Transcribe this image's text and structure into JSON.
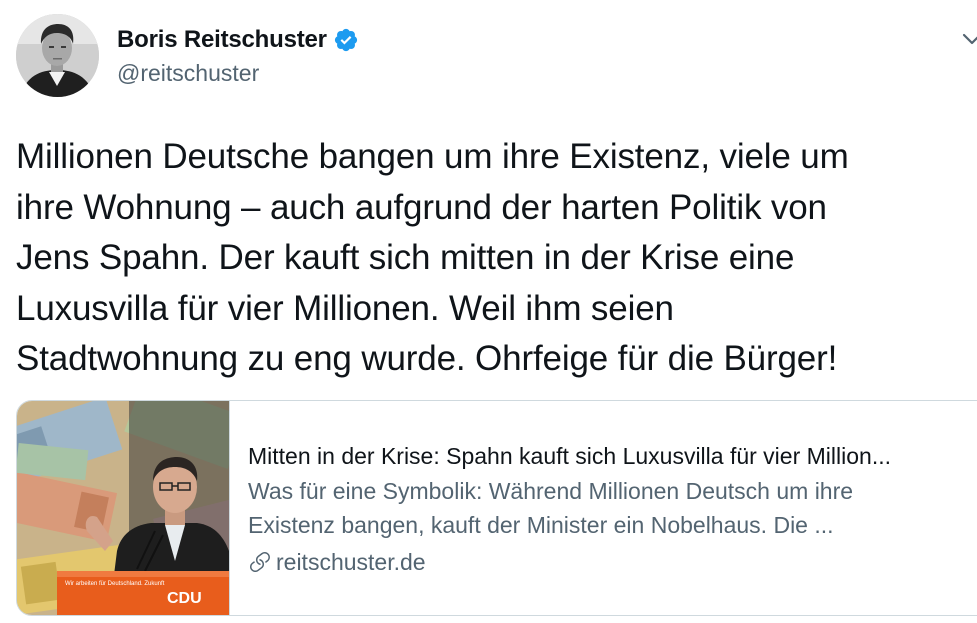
{
  "author": {
    "name": "Boris Reitschuster",
    "handle": "@reitschuster",
    "verified": true
  },
  "tweet": {
    "lines": [
      "Millionen Deutsche bangen um ihre Existenz, viele um",
      "ihre Wohnung – auch aufgrund der harten Politik von",
      "Jens Spahn. Der kauft sich mitten in der Krise eine",
      "Luxusvilla für vier Millionen. Weil ihm seien",
      "Stadtwohnung zu eng wurde. Ohrfeige für die Bürger!"
    ]
  },
  "card": {
    "title": "Mitten in der Krise: Spahn kauft sich Luxusvilla für vier Million...",
    "description_lines": [
      "Was für eine Symbolik: Während Millionen Deutsch um ihre",
      "Existenz bangen, kauft der Minister ein Nobelhaus. Die ..."
    ],
    "domain": "reitschuster.de",
    "thumbnail": {
      "podium_label": "CDU",
      "podium_small_text": "Wir arbeiten für Deutschland. Zukunft"
    }
  },
  "icons": {
    "verified": "verified-badge-icon",
    "more": "chevron-down-icon",
    "link": "link-icon"
  },
  "colors": {
    "verified_blue": "#1d9bf0",
    "secondary_text": "#536471",
    "cdu_orange": "#e85d1c"
  }
}
